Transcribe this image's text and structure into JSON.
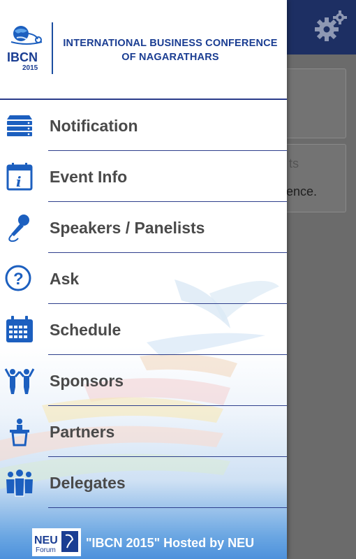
{
  "header": {
    "logo_text": "IBCN",
    "logo_year": "2015",
    "title_line1": "INTERNATIONAL BUSINESS CONFERENCE",
    "title_line2": "OF NAGARATHARS"
  },
  "menu": {
    "items": [
      {
        "label": "Notification",
        "icon": "server-stack-icon"
      },
      {
        "label": "Event Info",
        "icon": "calendar-info-icon"
      },
      {
        "label": "Speakers / Panelists",
        "icon": "microphone-icon"
      },
      {
        "label": "Ask",
        "icon": "question-circle-icon"
      },
      {
        "label": "Schedule",
        "icon": "calendar-grid-icon"
      },
      {
        "label": "Sponsors",
        "icon": "people-cheer-icon"
      },
      {
        "label": "Partners",
        "icon": "podium-icon"
      },
      {
        "label": "Delegates",
        "icon": "group-icon"
      }
    ]
  },
  "footer": {
    "logo_text": "NEU",
    "logo_subtext": "Forum",
    "text": "\"IBCN 2015\" Hosted by NEU"
  },
  "background": {
    "partial_text_1": "ts",
    "partial_text_2": "ence."
  },
  "colors": {
    "primary": "#1a3d92",
    "topbar": "#1d2f63",
    "icon_blue": "#1c5fbf",
    "label": "#4a4a4a"
  }
}
